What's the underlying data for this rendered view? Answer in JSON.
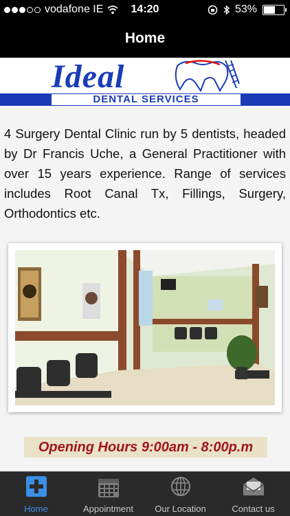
{
  "status_bar": {
    "carrier": "vodafone IE",
    "time": "14:20",
    "battery": "53%"
  },
  "nav": {
    "title": "Home"
  },
  "logo": {
    "word": "Ideal",
    "subtitle": "DENTAL SERVICES"
  },
  "description": "4 Surgery Dental Clinic run by 5 dentists, headed by Dr Francis Uche, a General Practitioner with over 15 years experience. Range of services includes Root Canal Tx, Fillings, Surgery, Orthodontics etc.",
  "opening_hours": "Opening Hours 9:00am - 8:00p.m",
  "tabs": [
    {
      "label": "Home",
      "icon": "plus-icon",
      "active": true
    },
    {
      "label": "Appointment",
      "icon": "calendar-icon",
      "active": false
    },
    {
      "label": "Our Location",
      "icon": "globe-icon",
      "active": false
    },
    {
      "label": "Contact us",
      "icon": "envelope-icon",
      "active": false
    }
  ],
  "colors": {
    "brand_blue": "#1a3cb8",
    "hours_text": "#a0141f",
    "tab_active": "#3a8ee6"
  }
}
